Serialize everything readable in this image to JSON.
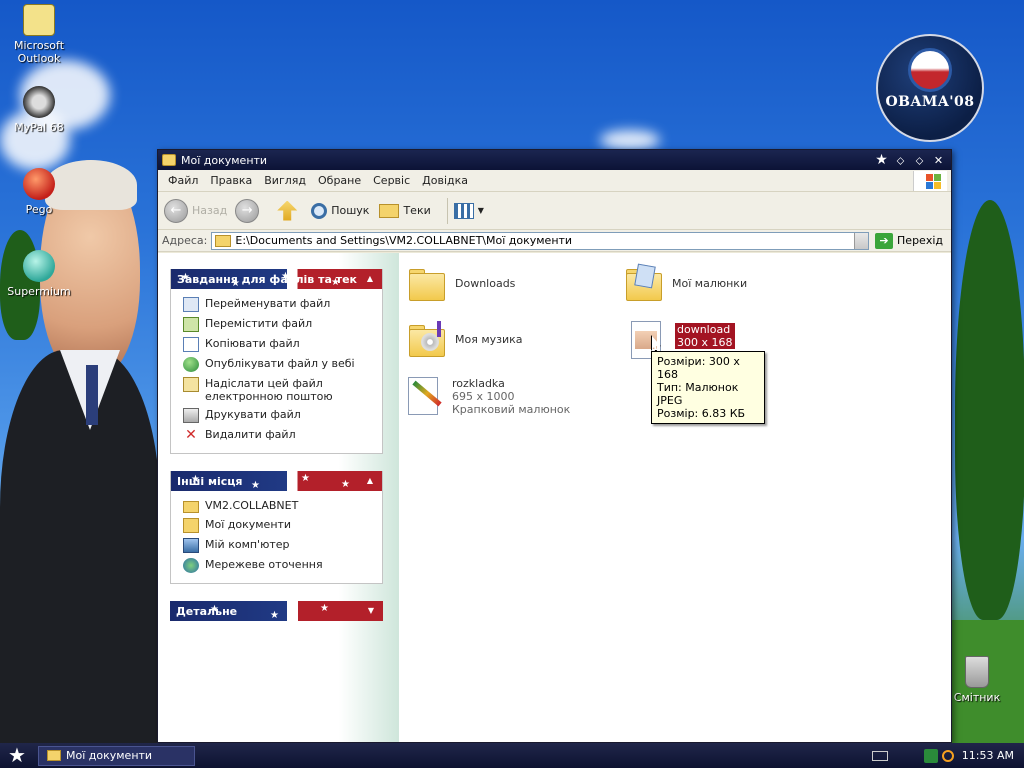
{
  "desktop": {
    "icons": [
      {
        "label": "Microsoft Outlook"
      },
      {
        "label": "MyPal 68"
      },
      {
        "label": "Pego"
      },
      {
        "label": "Supermium"
      },
      {
        "label": "Смітник"
      }
    ],
    "logo_text": "OBAMA'08"
  },
  "window": {
    "title": "Мої документи",
    "menu": [
      "Файл",
      "Правка",
      "Вигляд",
      "Обране",
      "Сервіс",
      "Довідка"
    ],
    "toolbar": {
      "back_label": "Назад",
      "search_label": "Пошук",
      "folders_label": "Теки"
    },
    "address": {
      "label": "Адреса:",
      "value": "E:\\Documents and Settings\\VM2.COLLABNET\\Мої документи",
      "go_label": "Перехід"
    },
    "panels": {
      "tasks": {
        "title": "Завдання для файлів та тек",
        "items": [
          "Перейменувати файл",
          "Перемістити файл",
          "Копіювати файл",
          "Опублікувати файл у вебі",
          "Надіслати цей файл електронною поштою",
          "Друкувати файл",
          "Видалити файл"
        ]
      },
      "places": {
        "title": "Інші місця",
        "items": [
          "VM2.COLLABNET",
          "Мої документи",
          "Мій комп'ютер",
          "Мережеве оточення"
        ]
      },
      "details": {
        "title": "Детальне"
      }
    },
    "files": [
      {
        "name": "Downloads"
      },
      {
        "name": "Мої малюнки"
      },
      {
        "name": "Моя музика"
      },
      {
        "name": "download",
        "sub1": "300 x 168"
      },
      {
        "name": "rozkladka",
        "sub1": "695 x 1000",
        "sub2": "Крапковий малюнок"
      }
    ],
    "tooltip": {
      "line1": "Розміри: 300 x 168",
      "line2": "Тип: Малюнок JPEG",
      "line3": "Розмір: 6.83 КБ"
    }
  },
  "taskbar": {
    "task_label": "Мої документи",
    "clock": "11:53 AM"
  },
  "colors": {
    "titlebar": "#0c1336",
    "panel_blue": "#1a2a6c",
    "panel_red": "#b3202a",
    "selection": "#a31422"
  }
}
